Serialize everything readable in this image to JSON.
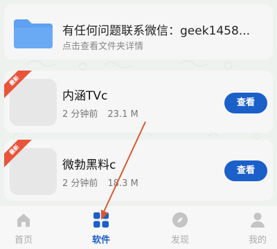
{
  "top_card": {
    "title": "有任何问题联系微信：geek1458...",
    "subtitle": "点击查看文件夹详情",
    "icon": "folder-icon"
  },
  "apps": [
    {
      "badge": "最新",
      "name": "内涵TVc",
      "time": "2 分钟前",
      "size": "23.1 M",
      "button": "查看"
    },
    {
      "badge": "最新",
      "name": "微勃黑料c",
      "time": "2 分钟前",
      "size": "18.3 M",
      "button": "查看"
    }
  ],
  "tabs": [
    {
      "label": "首页",
      "icon": "home-icon",
      "active": false
    },
    {
      "label": "软件",
      "icon": "apps-grid-icon",
      "active": true
    },
    {
      "label": "发现",
      "icon": "compass-icon",
      "active": false
    },
    {
      "label": "我的",
      "icon": "user-icon",
      "active": false
    }
  ],
  "colors": {
    "accent": "#1b5fc9",
    "badge": "#e8553a",
    "folder": "#5ea1f0",
    "annotation_arrow": "#d9572e"
  }
}
